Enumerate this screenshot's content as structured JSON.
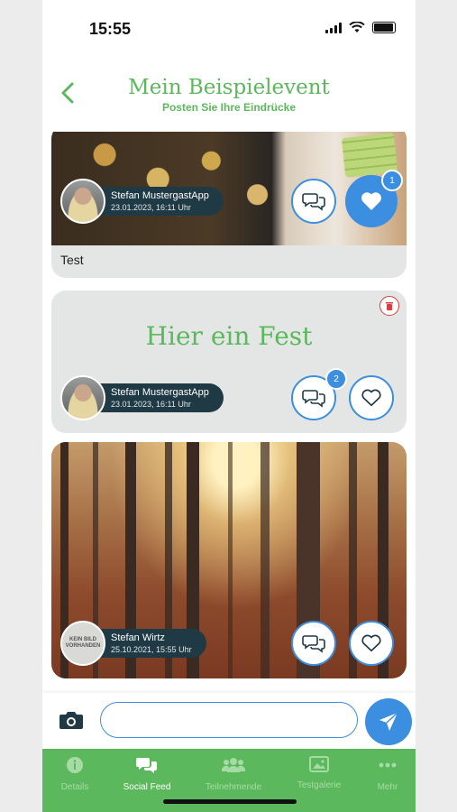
{
  "status": {
    "time": "15:55"
  },
  "header": {
    "title": "Mein Beispielevent",
    "subtitle": "Posten Sie Ihre Eindrücke"
  },
  "posts": [
    {
      "author": "Stefan MustergastApp",
      "date": "23.01.2023, 16:11 Uhr",
      "caption": "Test",
      "likes": "1",
      "liked": true
    },
    {
      "author": "Stefan MustergastApp",
      "date": "23.01.2023, 16:11 Uhr",
      "text": "Hier ein Fest",
      "comments": "2"
    },
    {
      "author": "Stefan Wirtz",
      "date": "25.10.2021, 15:55 Uhr",
      "avatar_text": "KEIN BILD VORHANDEN"
    }
  ],
  "composer": {
    "value": ""
  },
  "tabs": [
    {
      "label": "Details",
      "icon": "info-icon"
    },
    {
      "label": "Social Feed",
      "icon": "chat-icon",
      "active": true
    },
    {
      "label": "Teilnehmende",
      "icon": "people-icon"
    },
    {
      "label": "Testgalerie",
      "icon": "gallery-icon"
    },
    {
      "label": "Mehr",
      "icon": "more-icon"
    }
  ],
  "colors": {
    "brand_green": "#5cb85c",
    "action_blue": "#3b8ee0",
    "pill_dark": "#1f3a44",
    "delete_red": "#e03a3a"
  }
}
